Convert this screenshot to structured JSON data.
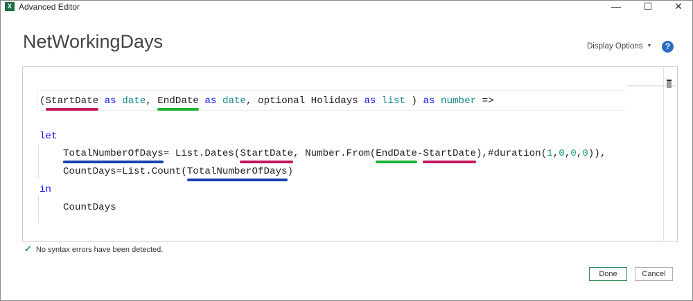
{
  "window": {
    "title": "Advanced Editor",
    "app_icon": "X",
    "minimize": "—",
    "maximize": "☐",
    "close": "✕"
  },
  "heading": "NetWorkingDays",
  "display_options": "Display Options",
  "help_label": "?",
  "colors": {
    "red": "#c0185a",
    "green": "#1db33a",
    "blue": "#1a3fb0"
  },
  "code_lines": [
    {
      "indent": 0,
      "tokens": [
        {
          "t": "("
        },
        {
          "t": "StartDate",
          "u": "red"
        },
        {
          "t": " "
        },
        {
          "t": "as",
          "c": "kw"
        },
        {
          "t": " "
        },
        {
          "t": "date",
          "c": "ty"
        },
        {
          "t": ", "
        },
        {
          "t": "EndDate",
          "u": "green"
        },
        {
          "t": " "
        },
        {
          "t": "as",
          "c": "kw"
        },
        {
          "t": " "
        },
        {
          "t": "date",
          "c": "ty"
        },
        {
          "t": ", optional Holidays "
        },
        {
          "t": "as",
          "c": "kw"
        },
        {
          "t": " "
        },
        {
          "t": "list",
          "c": "ty"
        },
        {
          "t": " ) "
        },
        {
          "t": "as",
          "c": "kw"
        },
        {
          "t": " "
        },
        {
          "t": "number",
          "c": "ty"
        },
        {
          "t": " =>"
        }
      ]
    },
    {
      "indent": 0,
      "tokens": [
        {
          "t": "let",
          "c": "kw"
        }
      ]
    },
    {
      "indent": 1,
      "tokens": [
        {
          "t": "TotalNumberOfDays",
          "u": "blue"
        },
        {
          "t": "= List.Dates("
        },
        {
          "t": "StartDate",
          "u": "red"
        },
        {
          "t": ", Number.From("
        },
        {
          "t": "EndDate",
          "u": "green"
        },
        {
          "t": "-"
        },
        {
          "t": "StartDate",
          "u": "red"
        },
        {
          "t": "),#duration("
        },
        {
          "t": "1",
          "c": "num"
        },
        {
          "t": ","
        },
        {
          "t": "0",
          "c": "num"
        },
        {
          "t": ","
        },
        {
          "t": "0",
          "c": "num"
        },
        {
          "t": ","
        },
        {
          "t": "0",
          "c": "num"
        },
        {
          "t": ")),"
        }
      ]
    },
    {
      "indent": 1,
      "tokens": [
        {
          "t": "CountDays=List.Count("
        },
        {
          "t": "TotalNumberOfDays",
          "u": "blue"
        },
        {
          "t": ")"
        }
      ]
    },
    {
      "indent": 0,
      "tokens": [
        {
          "t": "in",
          "c": "kw"
        }
      ]
    },
    {
      "indent": 1,
      "tokens": [
        {
          "t": "CountDays"
        }
      ]
    }
  ],
  "status": "No syntax errors have been detected.",
  "buttons": {
    "done": "Done",
    "cancel": "Cancel"
  }
}
